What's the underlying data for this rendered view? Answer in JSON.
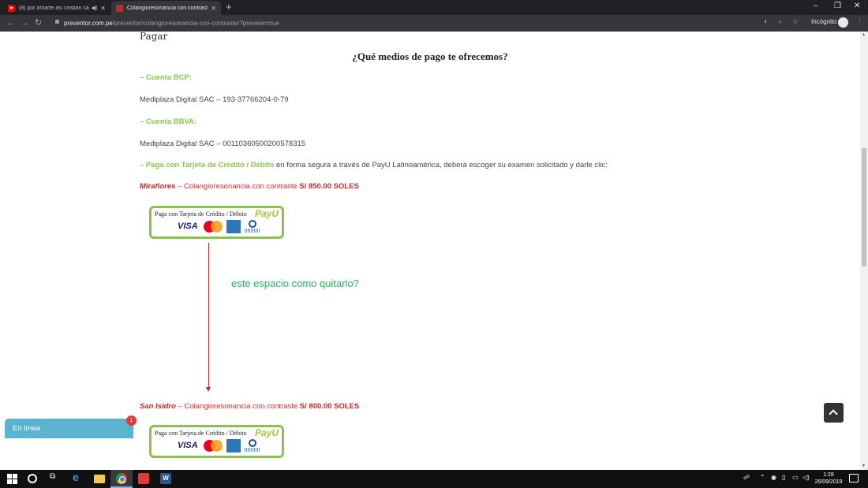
{
  "browser": {
    "tabs": [
      {
        "title": "(8) por amarte asi cristian ca",
        "icon": "youtube-icon"
      },
      {
        "title": "Colangioresonancia con contrast",
        "icon": "site-favicon"
      }
    ],
    "url_host": "preventor.com.pe",
    "url_path": "/preventor/colangioresonancia-con-contraste/?preview=true",
    "incognito_label": "Incógnito"
  },
  "page": {
    "pagar": "Pagar",
    "question": "¿Qué medios de pago te ofrecemos?",
    "bcp_label": "– Cuenta BCP:",
    "bcp_account": "Mediplaza Digital SAC – 193-37766204-0-79",
    "bbva_label": "– Cuenta BBVA:",
    "bbva_account": "Mediplaza Digital SAC – 0011036050020057831​5",
    "card_label": "– Paga con Tarjeta de Crédito / Débito",
    "card_text": " en forma segura a través de PayU Latinoamérica, deberá escoger su examen solicitado y darle clic:",
    "loc1_name": "Miraflores",
    "loc1_desc": " – Colangioresonancia con contraste ",
    "loc1_price": "S/ 850.00 SOLES",
    "loc2_name": "San Isidro",
    "loc2_desc": " – Colangioresonancia con contraste ",
    "loc2_price": "S/ 800.00 SOLES",
    "pay_button_text": "Paga con Tarjeta de Crédito / Débito",
    "pay_brand": "PayU",
    "visa": "VISA",
    "annotation": "este espacio como quitarlo?"
  },
  "chat": {
    "label": "En línea",
    "badge": "1"
  },
  "taskbar": {
    "time": "1:28",
    "date": "26/09/2019"
  }
}
